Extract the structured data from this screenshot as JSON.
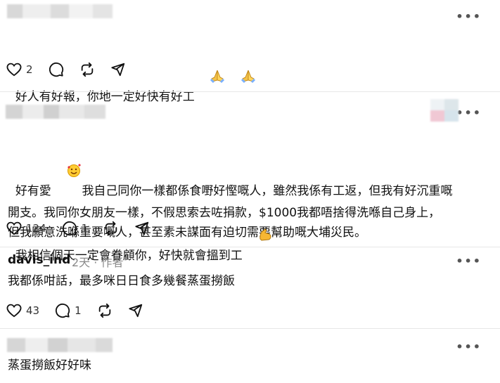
{
  "post1": {
    "text": "好人有好報，你地一定好快有好工",
    "emoji_icons": [
      "pray-hands-icon",
      "pray-hands-icon"
    ],
    "likes": "2",
    "replies": "",
    "reposts": ""
  },
  "post2": {
    "text1": "好有愛",
    "text2": "我自己同你一樣都係食嘢好慳嘅人，雖然我係有工返，但我有好沉重嘅\n開支。我同你女朋友一樣，不假思索去咗捐款，$1000我都唔捨得洗喺自己身上，\n但我願意洗喺重要嘅人，甚至素未謀面有迫切需要幫助嘅大埔災民。",
    "text3": "我相信個天一定會眷顧你，好快就會搵到工",
    "emoji_icons": [
      "smiling-hearts-icon",
      "flexed-biceps-icon"
    ],
    "likes": "124",
    "replies": "1",
    "reposts": ""
  },
  "post3": {
    "username": "davis_ind",
    "time": "2天",
    "dot": "·",
    "role": "作者",
    "text": "我都係咁話，最多咪日日食多幾餐蒸蛋撈飯",
    "likes": "43",
    "replies": "1",
    "reposts": ""
  },
  "post4": {
    "text": "蒸蛋撈飯好好味"
  },
  "colors": {
    "text": "#111111",
    "muted": "#8a8a8a",
    "divider": "#e7e7e7"
  }
}
